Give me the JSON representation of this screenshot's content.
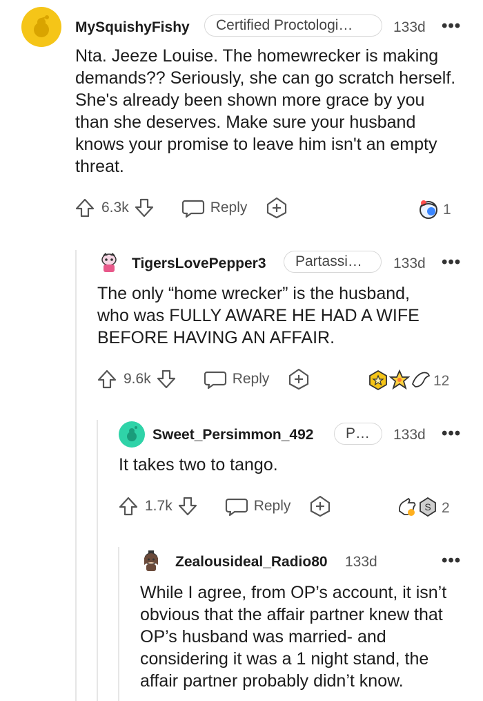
{
  "comments": [
    {
      "username": "MySquishyFishy",
      "flair": "Certified Proctologi…",
      "age": "133d",
      "body": "Nta. Jeeze Louise. The homewrecker is making demands?? Seriously, she can go scratch herself. She's already been shown more grace by you than she deserves. Make sure your husband knows your promise to leave him isn't an empty threat.",
      "votes": "6.3k",
      "reply_label": "Reply",
      "awards_count": "1",
      "avatar_color": "#f5c518"
    },
    {
      "username": "TigersLovePepper3",
      "flair": "Partassi…",
      "age": "133d",
      "body": "The only “home wrecker” is the husband, who was FULLY AWARE HE HAD A WIFE BEFORE HAVING AN AFFAIR.",
      "votes": "9.6k",
      "reply_label": "Reply",
      "awards_count": "12",
      "avatar_color": "#e8588a"
    },
    {
      "username": "Sweet_Persimmon_492",
      "flair": "P…",
      "age": "133d",
      "body": "It takes two to tango.",
      "votes": "1.7k",
      "reply_label": "Reply",
      "awards_count": "2",
      "avatar_color": "#2fd3a8"
    },
    {
      "username": "Zealousideal_Radio80",
      "age": "133d",
      "body": "While I agree, from OP’s account, it isn’t obvious that the affair partner knew that OP’s husband was married- and considering it was a 1 night stand, the affair partner probably didn’t know.",
      "avatar_color": "#6b4a3a"
    }
  ],
  "more_glyph": "•••"
}
